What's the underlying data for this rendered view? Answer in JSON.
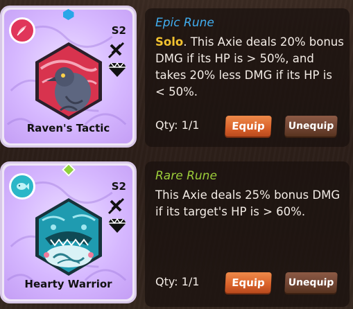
{
  "runes": [
    {
      "season": "S2",
      "name": "Raven's Tactic",
      "rarity": "Epic Rune",
      "keyword": "Solo",
      "description": ". This Axie deals 20% bonus DMG if its HP is > 50%, and takes 20% less DMG if its HP is < 50%.",
      "qty_label": "Qty: 1/1",
      "equip_label": "Equip",
      "unequip_label": "Unequip",
      "class_color": "#e0365a",
      "gem_color": "#29a6e8",
      "class_icon": "feather-icon",
      "art_icon": "raven-icon"
    },
    {
      "season": "S2",
      "name": "Hearty Warrior",
      "rarity": "Rare Rune",
      "keyword": "",
      "description": "This Axie deals 25% bonus DMG if its target's HP is > 60%.",
      "qty_label": "Qty: 1/1",
      "equip_label": "Equip",
      "unequip_label": "Unequip",
      "class_color": "#2bb7c8",
      "gem_color": "#8fd13b",
      "class_icon": "fish-icon",
      "art_icon": "shark-icon"
    }
  ]
}
